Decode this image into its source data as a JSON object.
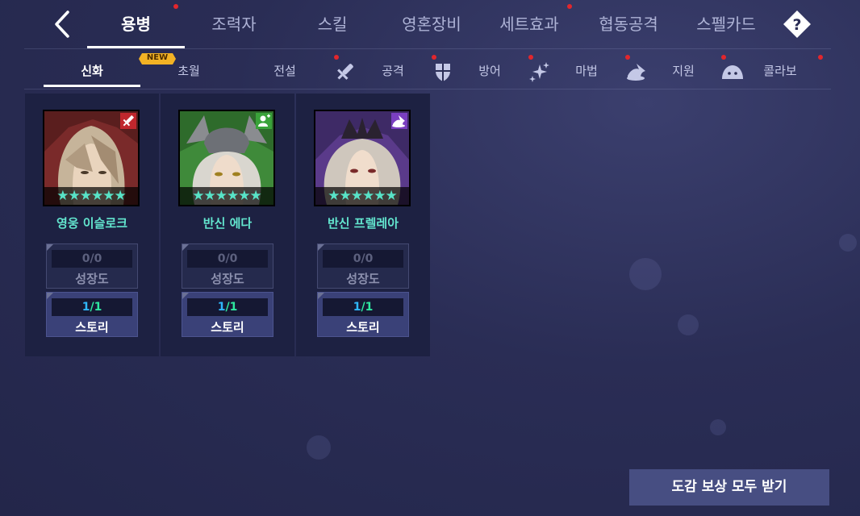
{
  "nav": {
    "tabs": [
      {
        "label": "용병",
        "active": true,
        "dot": true
      },
      {
        "label": "조력자",
        "active": false,
        "dot": false
      },
      {
        "label": "스킬",
        "active": false,
        "dot": false
      },
      {
        "label": "영혼장비",
        "active": false,
        "dot": false
      },
      {
        "label": "세트효과",
        "active": false,
        "dot": true
      },
      {
        "label": "협동공격",
        "active": false,
        "dot": false
      },
      {
        "label": "스펠카드",
        "active": false,
        "dot": false
      }
    ],
    "help_glyph": "?"
  },
  "subnav": {
    "tabs": [
      {
        "label": "신화",
        "active": true
      },
      {
        "label": "초월",
        "active": false
      },
      {
        "label": "전설",
        "active": false
      }
    ],
    "new_badge": "NEW",
    "filters": [
      {
        "label": "공격",
        "icon": "sword-icon",
        "dot": true
      },
      {
        "label": "방어",
        "icon": "shield-icon",
        "dot": true
      },
      {
        "label": "마법",
        "icon": "magic-sparkle-icon",
        "dot": true
      },
      {
        "label": "지원",
        "icon": "support-icon",
        "dot": true
      },
      {
        "label": "콜라보",
        "icon": "slime-icon",
        "dot": true
      }
    ]
  },
  "mercenaries": [
    {
      "name": "영웅 이슬로크",
      "stars": "★★★★★★",
      "class_icon": "sword-icon",
      "growth": {
        "current": "0",
        "total": "0",
        "label": "성장도"
      },
      "story": {
        "current": "1",
        "total": "1",
        "label": "스토리"
      }
    },
    {
      "name": "반신 에다",
      "stars": "★★★★★★",
      "class_icon": "support-icon",
      "growth": {
        "current": "0",
        "total": "0",
        "label": "성장도"
      },
      "story": {
        "current": "1",
        "total": "1",
        "label": "스토리"
      }
    },
    {
      "name": "반신 프렐레아",
      "stars": "★★★★★★",
      "class_icon": "magic-hat-icon",
      "growth": {
        "current": "0",
        "total": "0",
        "label": "성장도"
      },
      "story": {
        "current": "1",
        "total": "1",
        "label": "스토리"
      }
    }
  ],
  "claim_all_button": "도감 보상 모두 받기",
  "colors": {
    "accent_teal": "#63e6cf",
    "star_color": "#58e3c7",
    "notify_red": "#e2262c",
    "story_current_blue": "#2fb8ff",
    "story_total_green": "#2ee8a0"
  }
}
